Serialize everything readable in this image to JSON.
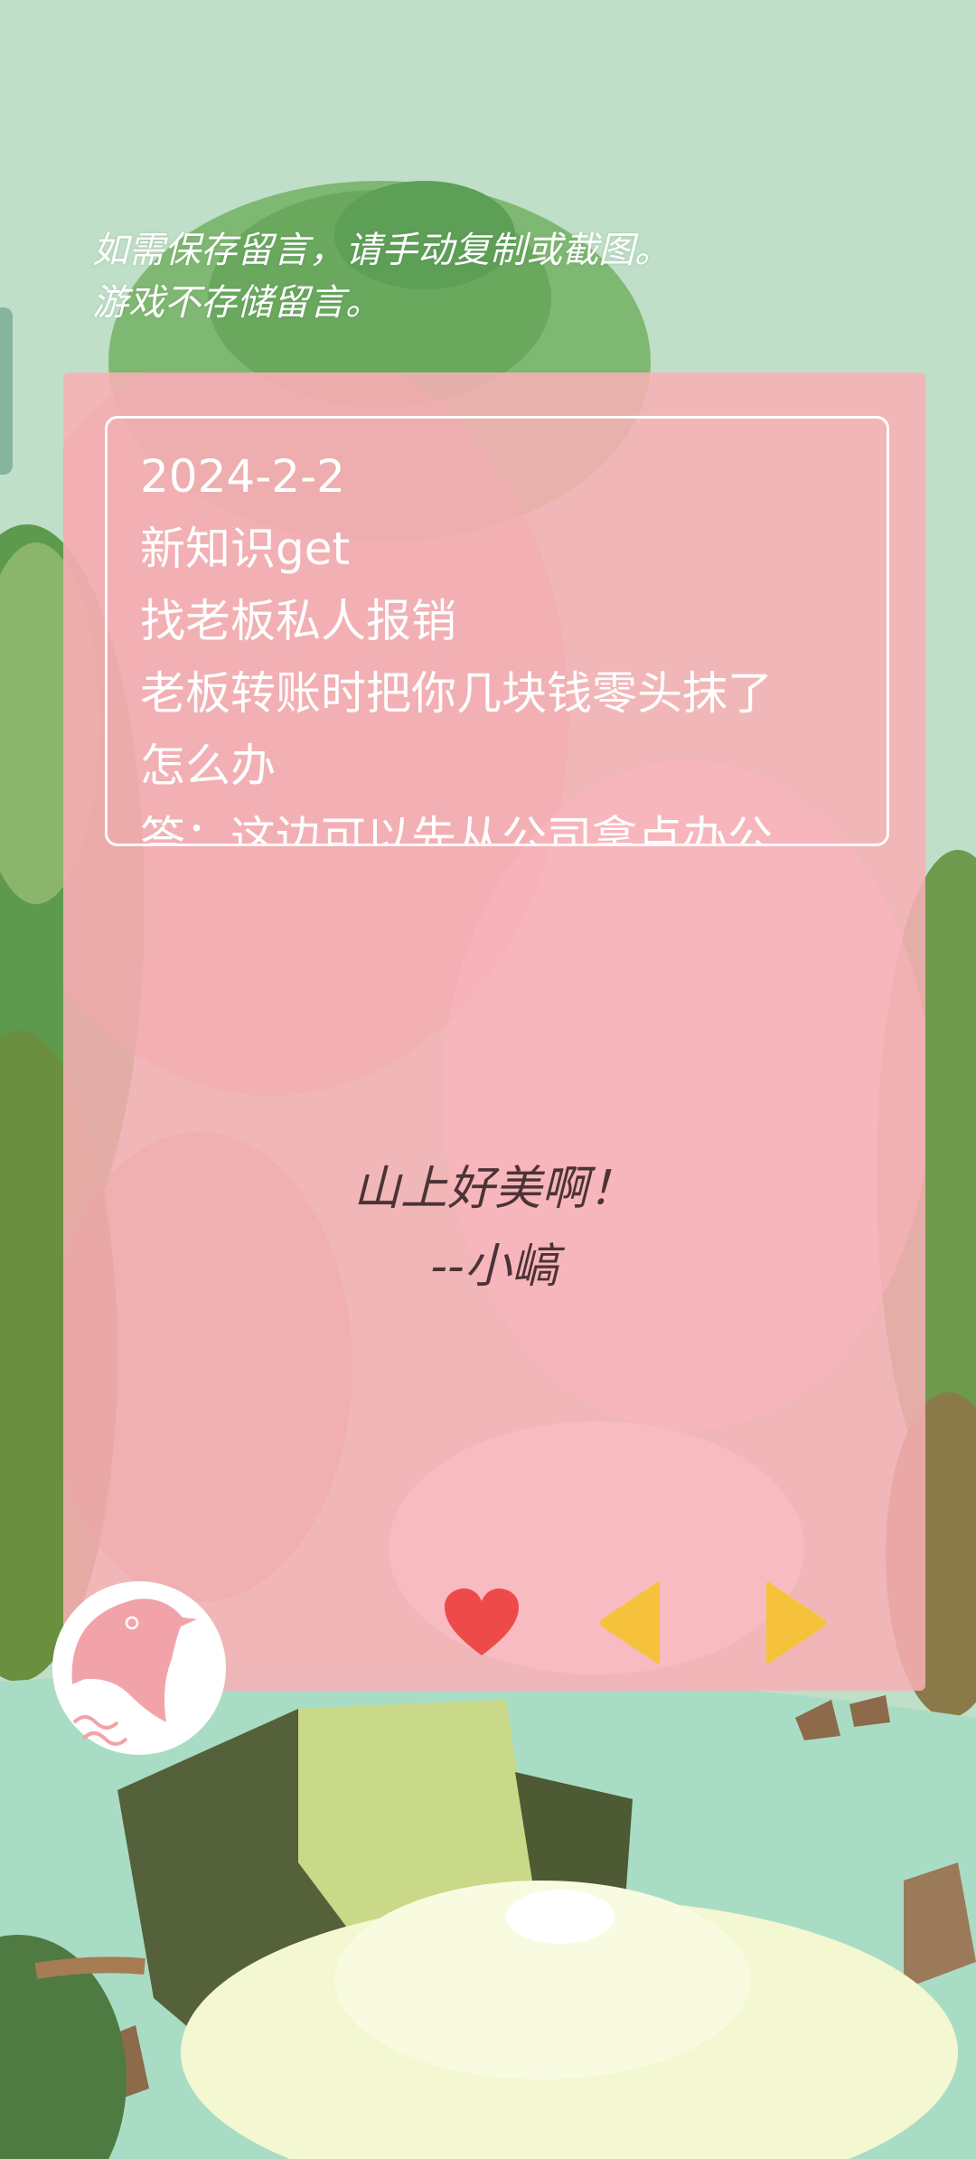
{
  "notice": {
    "line1": "如需保存留言，请手动复制或截图。",
    "line2": "游戏不存储留言。"
  },
  "message": {
    "lines": [
      "2024-2-2",
      "新知识get",
      "找老板私人报销",
      "老板转账时把你几块钱零头抹了",
      "怎么办",
      "答：这边可以先从公司拿点办公"
    ]
  },
  "quote": {
    "text": "山上好美啊！",
    "author": "--小嵪"
  },
  "icons": {
    "bird": "bird-logo-icon",
    "like": "heart-icon",
    "prev": "triangle-left-icon",
    "next": "triangle-right-icon"
  },
  "colors": {
    "background": "#bfdfc8",
    "panel": "#f9b0b6",
    "heart": "#ef4a4a",
    "arrows": "#f6c23b",
    "quote_text": "#4b3336"
  }
}
